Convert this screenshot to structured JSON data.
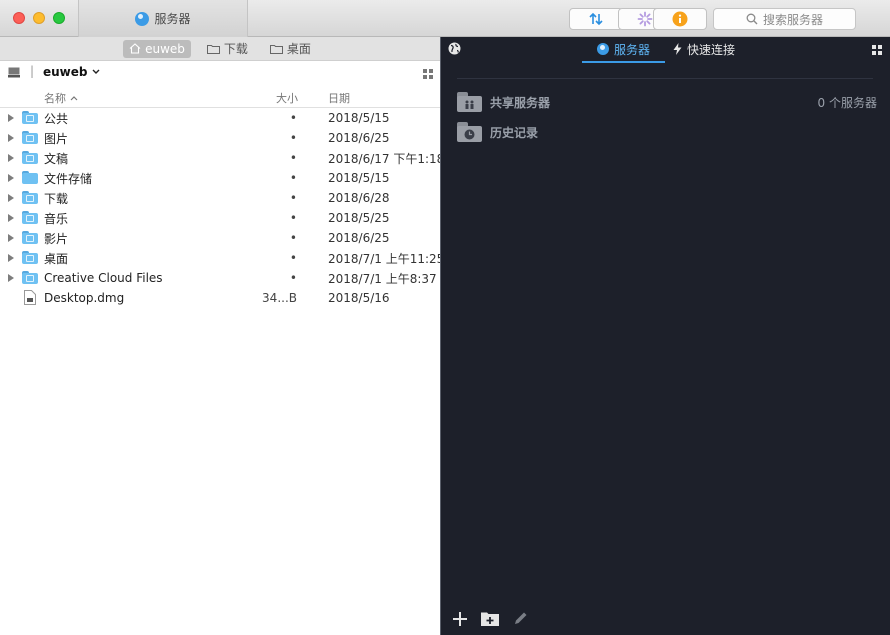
{
  "titlebar": {
    "tab_title": "服务器",
    "search_placeholder": "搜索服务器",
    "buttons": [
      {
        "name": "sync-button",
        "icon": "up-down-arrows-icon"
      },
      {
        "name": "activity-button",
        "icon": "spinner-icon"
      },
      {
        "name": "info-button",
        "icon": "info-icon"
      }
    ]
  },
  "left": {
    "breadcrumbs": [
      {
        "label": "euweb",
        "icon": "home-icon",
        "active": true
      },
      {
        "label": "下载",
        "icon": "folder-icon",
        "active": false
      },
      {
        "label": "桌面",
        "icon": "folder-icon",
        "active": false
      }
    ],
    "location": "euweb",
    "columns": {
      "name": "名称",
      "size": "大小",
      "date": "日期"
    },
    "files": [
      {
        "name": "公共",
        "size": "•",
        "date": "2018/5/15",
        "folder": true
      },
      {
        "name": "图片",
        "size": "•",
        "date": "2018/6/25",
        "folder": true
      },
      {
        "name": "文稿",
        "size": "•",
        "date": "2018/6/17 下午1:18",
        "folder": true
      },
      {
        "name": "文件存储",
        "size": "•",
        "date": "2018/5/15",
        "folder": true
      },
      {
        "name": "下载",
        "size": "•",
        "date": "2018/6/28",
        "folder": true
      },
      {
        "name": "音乐",
        "size": "•",
        "date": "2018/5/25",
        "folder": true
      },
      {
        "name": "影片",
        "size": "•",
        "date": "2018/6/25",
        "folder": true
      },
      {
        "name": "桌面",
        "size": "•",
        "date": "2018/7/1 上午11:25",
        "folder": true
      },
      {
        "name": "Creative Cloud Files",
        "size": "•",
        "date": "2018/7/1 上午8:37",
        "folder": true
      },
      {
        "name": "Desktop.dmg",
        "size": "34...B",
        "date": "2018/5/16",
        "folder": false
      }
    ]
  },
  "right": {
    "tabs": [
      {
        "label": "服务器",
        "active": true
      },
      {
        "label": "快速连接",
        "active": false
      }
    ],
    "items": [
      {
        "label": "共享服务器",
        "icon": "shared-folder-icon"
      },
      {
        "label": "历史记录",
        "icon": "history-folder-icon"
      }
    ],
    "server_count": "0 个服务器"
  },
  "colors": {
    "accent": "#3b9be6",
    "dark_bg": "#1d202a",
    "folder": "#6fc1f2"
  }
}
